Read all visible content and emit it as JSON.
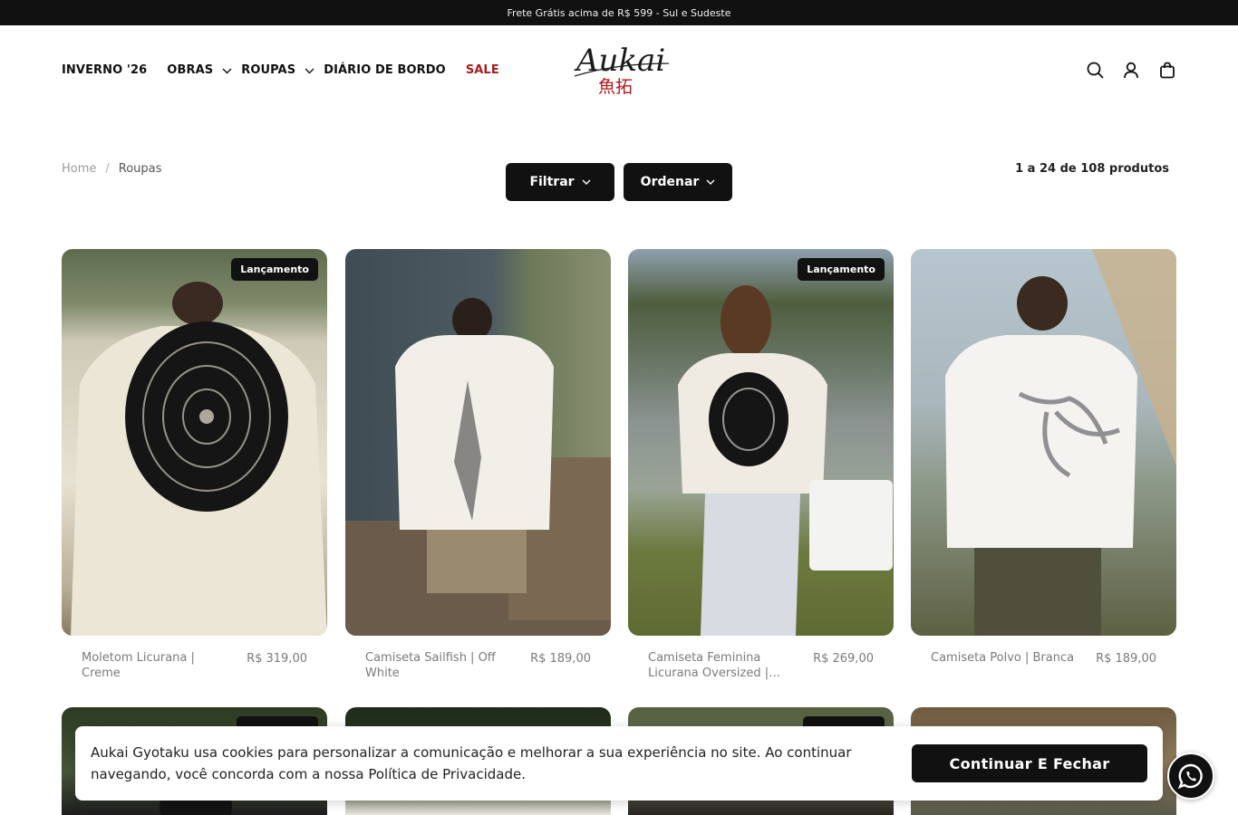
{
  "announcement": "Frete Grátis acima de R$ 599 - Sul e Sudeste",
  "nav": {
    "items": [
      {
        "label": "INVERNO '26",
        "has_dropdown": false
      },
      {
        "label": "OBRAS",
        "has_dropdown": true
      },
      {
        "label": "ROUPAS",
        "has_dropdown": true
      },
      {
        "label": "DIÁRIO DE BORDO",
        "has_dropdown": false
      },
      {
        "label": "SALE",
        "has_dropdown": false
      }
    ]
  },
  "logo": {
    "script_text": "Aukai",
    "kanji": "魚拓"
  },
  "header_icons": [
    "search-icon",
    "account-icon",
    "cart-icon"
  ],
  "breadcrumb": {
    "home": "Home",
    "separator": "/",
    "current": "Roupas"
  },
  "toolbar": {
    "filter_label": "Filtrar",
    "sort_label": "Ordenar",
    "count": "1 a 24 de 108 produtos"
  },
  "products": [
    {
      "name": "Moletom Licurana | Creme",
      "price": "R$ 319,00",
      "badge": "Lançamento"
    },
    {
      "name": "Camiseta Sailfish | Off White",
      "price": "R$ 189,00",
      "badge": ""
    },
    {
      "name": "Camiseta Feminina Licurana Oversized | Off…",
      "price": "R$ 269,00",
      "badge": "Lançamento"
    },
    {
      "name": "Camiseta Polvo | Branca",
      "price": "R$ 189,00",
      "badge": ""
    }
  ],
  "cookie": {
    "text": "Aukai Gyotaku usa cookies para personalizar a comunicação e melhorar a sua experiência no site. Ao continuar navegando, você concorda com a nossa Política de Privacidade.",
    "button": "Continuar E Fechar"
  },
  "colors": {
    "dark": "#111111",
    "sale": "#a51d1d",
    "muted": "#7a7a7a"
  }
}
